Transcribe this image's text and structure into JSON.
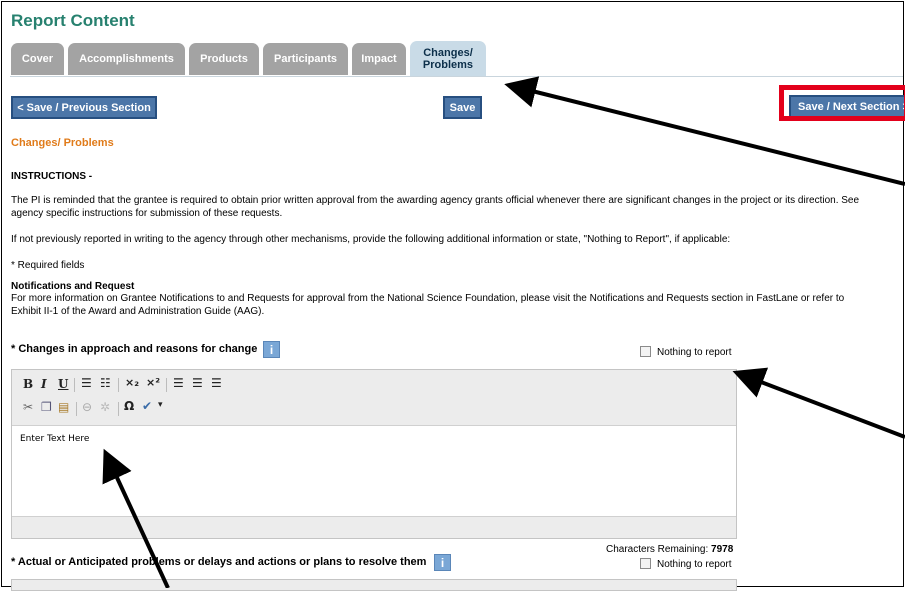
{
  "page": {
    "title": "Report Content"
  },
  "tabs": [
    {
      "label": "Cover"
    },
    {
      "label": "Accomplishments"
    },
    {
      "label": "Products"
    },
    {
      "label": "Participants"
    },
    {
      "label": "Impact"
    },
    {
      "label_line1": "Changes/",
      "label_line2": "Problems",
      "active": true
    }
  ],
  "buttons": {
    "previous": "< Save / Previous Section",
    "save": "Save",
    "next": "Save / Next Section >"
  },
  "section": {
    "heading": "Changes/ Problems",
    "instructions_title": "INSTRUCTIONS -",
    "instructions_p1_line1": "The PI is reminded that the grantee is required to obtain prior written approval from the awarding agency grants official whenever there are significant changes in the project or its direction. See",
    "instructions_p1_line2": "agency specific instructions for submission of these requests.",
    "instructions_p2": "If not previously reported in writing to the agency through other mechanisms, provide the following additional information or state, \"Nothing to Report\", if applicable:",
    "required_note": "* Required fields",
    "notif_title": "Notifications and Request",
    "notif_line1": "For more information on Grantee Notifications to and Requests for approval from the National Science Foundation, please visit the Notifications and Requests section in FastLane or refer to",
    "notif_line2": "Exhibit II-1 of the Award and Administration Guide (AAG)."
  },
  "field1": {
    "label": "* Changes in approach and reasons for change",
    "nothing_label": "Nothing to report",
    "editor_text": "Enter Text Here"
  },
  "field2": {
    "chars_label": "Characters Remaining: ",
    "chars_value": "7978",
    "label": "* Actual or Anticipated problems or delays and actions or plans to resolve them",
    "nothing_label": "Nothing to report"
  },
  "toolbar": {
    "bold": "B",
    "italic": "I",
    "underline": "U",
    "subscript": "×₂",
    "superscript": "×²",
    "special_char": "Ω"
  },
  "colors": {
    "accent": "#27816f",
    "button": "#4c76a8",
    "tab_active": "#c9dbe7",
    "highlight": "#e3001b",
    "heading": "#e07b1a"
  }
}
